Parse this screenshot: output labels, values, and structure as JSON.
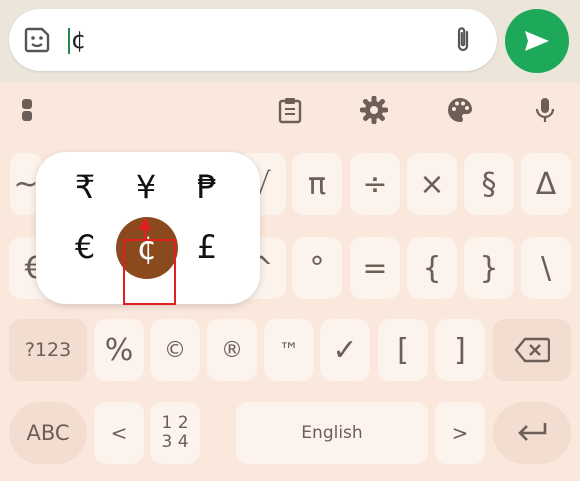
{
  "compose": {
    "text": "¢",
    "icons": [
      "sticker-icon",
      "paperclip-icon",
      "send-icon"
    ]
  },
  "toolbar": {
    "icons": [
      "apps-grid-icon",
      "clipboard-icon",
      "settings-gear-icon",
      "palette-icon",
      "microphone-icon"
    ]
  },
  "currency_popup": {
    "row1": [
      "₹",
      "¥",
      "₱"
    ],
    "row2": [
      "€",
      "¢",
      "£"
    ],
    "selected": "¢"
  },
  "keys": {
    "row1": [
      "~",
      "√",
      "π",
      "÷",
      "×",
      "§",
      "Δ"
    ],
    "row2": [
      "€",
      "¥",
      "$",
      "¢",
      "^",
      "°",
      "=",
      "{",
      "}",
      "\\"
    ],
    "row3": [
      "?123",
      "%",
      "©",
      "®",
      "™",
      "✓",
      "[",
      "]"
    ],
    "row4": [
      "ABC",
      "<",
      "1 2",
      "3 4",
      "English",
      ">"
    ]
  },
  "colors": {
    "send_green": "#1ea85a",
    "keyboard_bg": "#fbe8dd",
    "popup_selected": "#8a4a1e",
    "highlight_red": "#e02020"
  }
}
